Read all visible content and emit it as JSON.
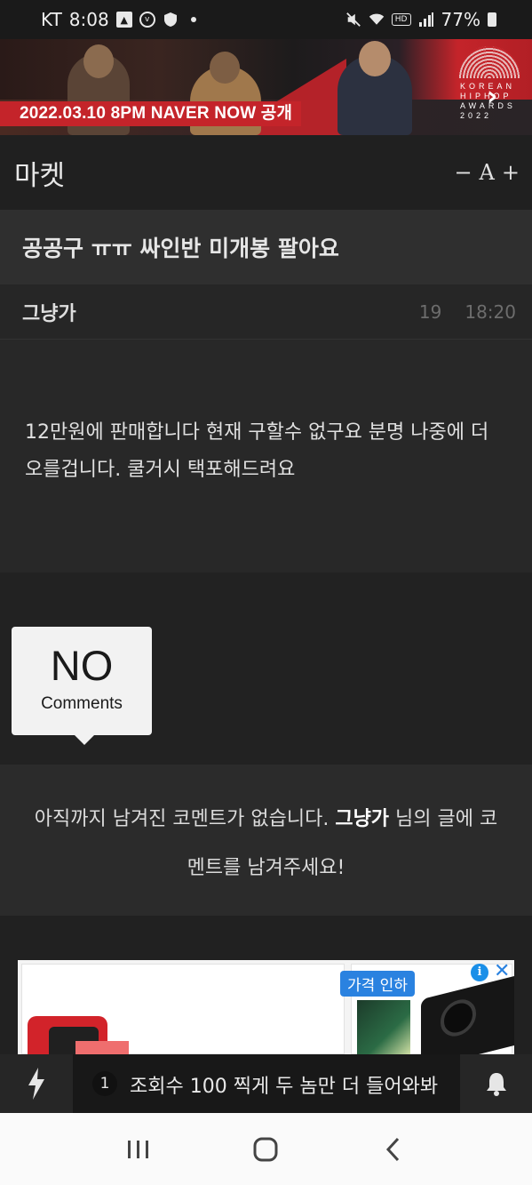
{
  "status_bar": {
    "carrier": "KT",
    "time": "8:08",
    "battery": "77%"
  },
  "banner": {
    "caption": "2022.03.10 8PM NAVER NOW 공개",
    "logo_text": "KOREAN HIPHOP AWARDS 2022"
  },
  "header": {
    "title": "마켓",
    "font_decrease": "−",
    "font_label": "A",
    "font_increase": "+"
  },
  "post": {
    "title": "공공구 ㅠㅠ 싸인반 미개봉 팔아요",
    "author": "그냥가",
    "views": "19",
    "time": "18:20",
    "body": "12만원에 판매합니다 현재 구할수 없구요 분명 나중에 더 오를겁니다. 쿨거시 택포해드려요"
  },
  "comments": {
    "bubble_big": "NO",
    "bubble_small": "Comments",
    "empty_prefix": "아직까지 남겨진 코멘트가 없습니다. ",
    "empty_author": "그냥가",
    "empty_suffix": " 님의 글에 코멘트를 남겨주세요!"
  },
  "ad": {
    "badge": "가격 인하",
    "info": "i",
    "close": "✕"
  },
  "app_bar": {
    "rank": "1",
    "ticker": "조회수 100 찍게 두 놈만 더 들어와봐"
  },
  "icons": {
    "status": [
      "mute-icon",
      "wifi-icon",
      "hd-icon",
      "signal-icon",
      "battery-icon"
    ],
    "app_bar": [
      "bolt-icon",
      "bell-icon"
    ],
    "nav": [
      "recents-icon",
      "home-icon",
      "back-icon"
    ]
  },
  "colors": {
    "background": "#1f1f1f",
    "title_row": "#2f2f2f",
    "banner_red": "#c4242a",
    "nav_bar": "#fafafa"
  }
}
